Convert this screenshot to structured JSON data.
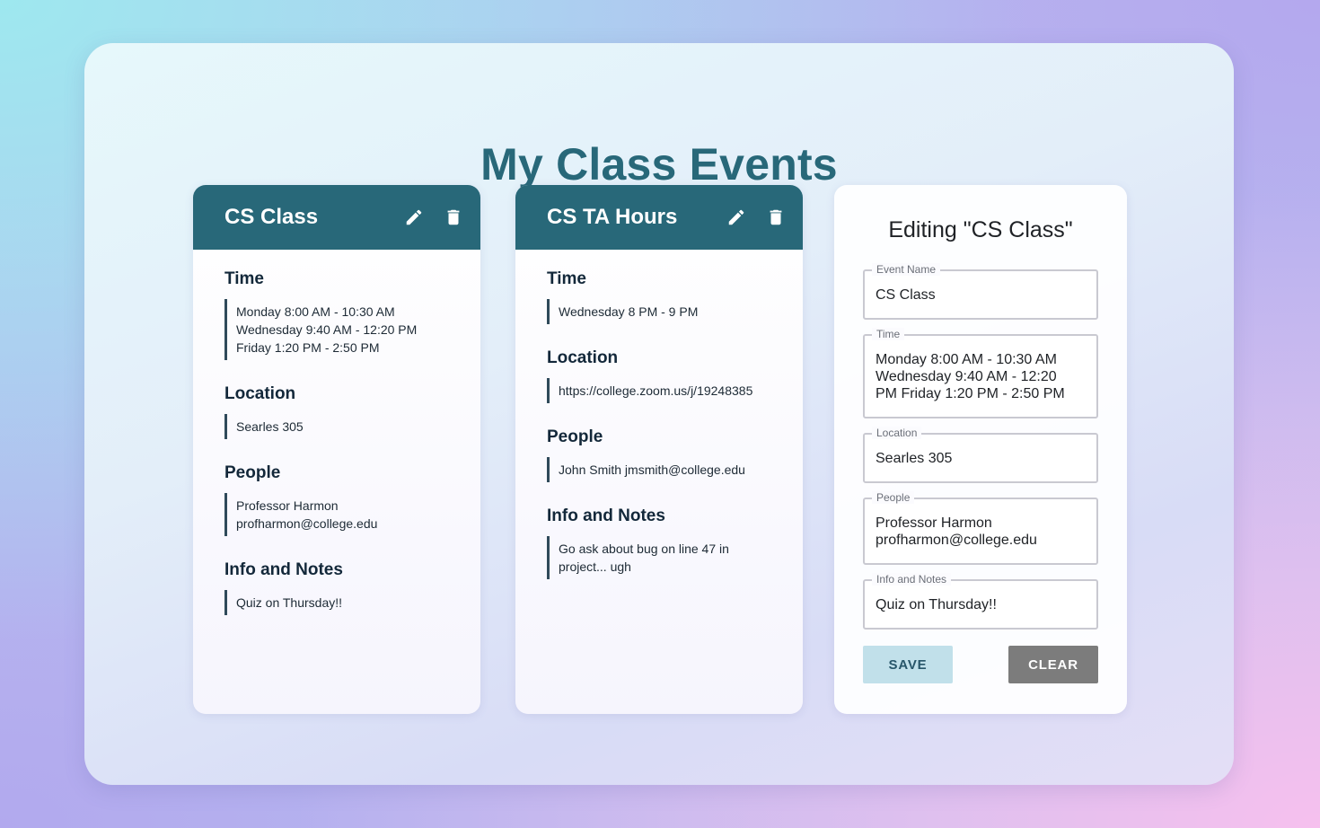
{
  "page": {
    "title": "My Class Events"
  },
  "cards": [
    {
      "title": "CS Class",
      "sections": [
        {
          "title": "Time",
          "lines": [
            "Monday 8:00 AM - 10:30 AM",
            "Wednesday 9:40 AM - 12:20 PM",
            "Friday 1:20 PM - 2:50 PM"
          ]
        },
        {
          "title": "Location",
          "lines": [
            "Searles 305"
          ]
        },
        {
          "title": "People",
          "lines": [
            "Professor Harmon",
            "profharmon@college.edu"
          ]
        },
        {
          "title": "Info and Notes",
          "lines": [
            "Quiz on Thursday!!"
          ]
        }
      ]
    },
    {
      "title": "CS TA Hours",
      "sections": [
        {
          "title": "Time",
          "lines": [
            "Wednesday 8 PM - 9 PM"
          ]
        },
        {
          "title": "Location",
          "lines": [
            "https://college.zoom.us/j/19248385"
          ]
        },
        {
          "title": "People",
          "lines": [
            "John Smith jmsmith@college.edu"
          ]
        },
        {
          "title": "Info and Notes",
          "lines": [
            "Go ask about bug on line 47 in",
            "project... ugh"
          ]
        }
      ]
    }
  ],
  "icons": {
    "edit": "pencil-icon",
    "delete": "trash-icon"
  },
  "editor": {
    "title": "Editing \"CS Class\"",
    "fields": [
      {
        "label": "Event Name",
        "lines": [
          "CS Class"
        ]
      },
      {
        "label": "Time",
        "lines": [
          "Monday 8:00 AM - 10:30 AM",
          "Wednesday 9:40 AM - 12:20",
          "PM Friday 1:20 PM - 2:50 PM"
        ]
      },
      {
        "label": "Location",
        "lines": [
          "Searles 305"
        ]
      },
      {
        "label": "People",
        "lines": [
          "Professor Harmon",
          "profharmon@college.edu"
        ]
      },
      {
        "label": "Info and Notes",
        "lines": [
          "Quiz on Thursday!!"
        ]
      }
    ],
    "save_label": "SAVE",
    "clear_label": "CLEAR"
  },
  "colors": {
    "accent": "#286879",
    "save_bg": "#c1e0ea",
    "clear_bg": "#7c7c7c"
  }
}
